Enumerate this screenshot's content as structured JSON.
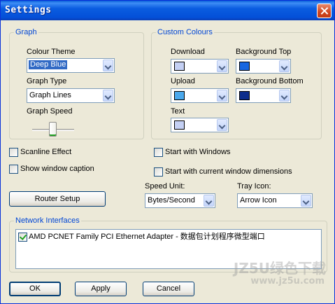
{
  "window": {
    "title": "Settings"
  },
  "graph": {
    "legend": "Graph",
    "colour_theme_label": "Colour Theme",
    "colour_theme_value": "Deep Blue",
    "graph_type_label": "Graph Type",
    "graph_type_value": "Graph Lines",
    "graph_speed_label": "Graph Speed"
  },
  "custom_colours": {
    "legend": "Custom Colours",
    "download_label": "Download",
    "download_color": "#c4d0f4",
    "background_top_label": "Background Top",
    "background_top_color": "#1866e0",
    "upload_label": "Upload",
    "upload_color": "#4aa8ec",
    "background_bottom_label": "Background Bottom",
    "background_bottom_color": "#0c2c8c",
    "text_label": "Text",
    "text_color": "#c4d0f4"
  },
  "options": {
    "scanline_effect": {
      "label": "Scanline Effect",
      "checked": false
    },
    "show_window_caption": {
      "label": "Show window caption",
      "checked": false
    },
    "start_with_windows": {
      "label": "Start with Windows",
      "checked": false
    },
    "start_with_dimensions": {
      "label": "Start with current window dimensions",
      "checked": false
    }
  },
  "router_setup_label": "Router Setup",
  "speed_unit": {
    "label": "Speed Unit:",
    "value": "Bytes/Second"
  },
  "tray_icon": {
    "label": "Tray Icon:",
    "value": "Arrow Icon"
  },
  "network": {
    "legend": "Network Interfaces",
    "items": [
      {
        "label": "AMD PCNET Family PCI Ethernet Adapter - 数据包计划程序微型端口",
        "checked": true
      }
    ]
  },
  "buttons": {
    "ok": "OK",
    "apply": "Apply",
    "cancel": "Cancel"
  },
  "watermark": {
    "line1": "JZ5U绿色下载",
    "line2": "www.jz5u.com"
  }
}
